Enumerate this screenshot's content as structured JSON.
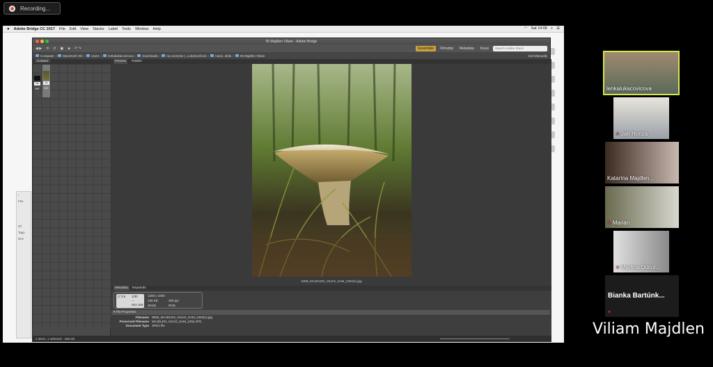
{
  "recording": {
    "label": "Recording..."
  },
  "menubar": {
    "apple": "",
    "app": "Adobe Bridge CC 2017",
    "items": [
      "File",
      "Edit",
      "View",
      "Stacks",
      "Label",
      "Tools",
      "Window",
      "Help"
    ],
    "clock": "Sat 14:06"
  },
  "bridge": {
    "window_title": "05 Majdlen Viliam - Adobe Bridge",
    "workspaces": [
      "Essentials",
      "Filmstrip",
      "Metadata",
      "Keyw"
    ],
    "active_workspace": "Essentials",
    "search_placeholder": "Search Adobe Stock",
    "path": [
      "Computer",
      "Macintosh HD",
      "Users",
      "lenkalukacovicova",
      "Downloads",
      "na ocenenie (..Lukačovičová",
      "Autori, diela",
      "05 Majdlen Viliam"
    ],
    "sort": "Sort Manually",
    "left_tab": "Content",
    "thumbs": [
      {
        "label": "WE"
      },
      {
        "label": "WE"
      }
    ],
    "preview_tabs": [
      "Preview",
      "Publish"
    ],
    "filename": "WEB_MAJDLEN_VILKO_SAM_2453(1).jpg",
    "metadata_tabs": [
      "Metadata",
      "Keywords"
    ],
    "badge": {
      "fstop": "ƒ/ 3.6",
      "shutter": "1/30",
      "dash": "--",
      "iso": "ISO 100",
      "dims": "1200 x 1600",
      "size": "235 KB",
      "ppi": "300 ppi",
      "color": "sRGB",
      "mode": "RGB"
    },
    "file_properties": "File Properties",
    "props": [
      {
        "k": "Filename",
        "v": "WEB_MAJDLEN_VILKO_SAM_2453(1).jpg"
      },
      {
        "k": "Preserved Filename",
        "v": "MAJDLEN_VILKO_SAM_2453.JPG"
      },
      {
        "k": "Document Type",
        "v": "JPEG file"
      }
    ],
    "status": "2 items, 1 selected - 235 KB"
  },
  "participants": [
    {
      "name": "lenkalukacovicova",
      "muted": false,
      "active": true
    },
    {
      "name": "Ján Honza",
      "muted": true
    },
    {
      "name": "Katarína Majdlen...",
      "muted": true
    },
    {
      "name": "Marián",
      "muted": true
    },
    {
      "name": "Martina Docol...",
      "muted": true
    },
    {
      "name": "Bianka Bartúnk...",
      "muted": true
    }
  ],
  "speaker": "Viliam Majdlen",
  "colors": {
    "accent": "#c9a23c",
    "active_border": "#d8e84a",
    "mute": "#e04a4a"
  }
}
